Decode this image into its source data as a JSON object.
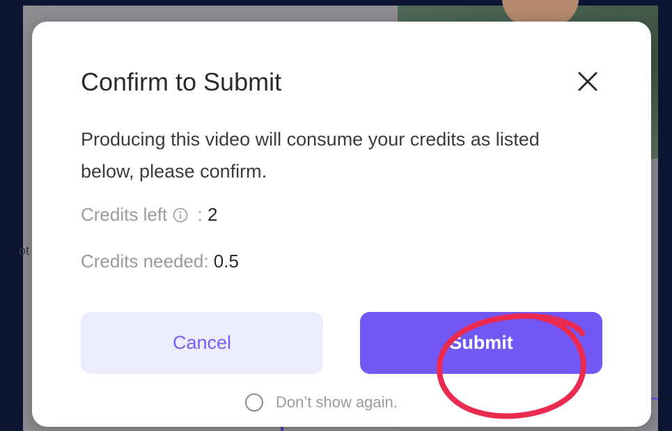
{
  "dialog": {
    "title": "Confirm to Submit",
    "description": "Producing this video will consume your credits as listed below, please confirm.",
    "credits_left_label": "Credits left",
    "credits_left_separator": " : ",
    "credits_left_value": "2",
    "credits_needed_label": "Credits needed: ",
    "credits_needed_value": "0.5",
    "cancel_label": "Cancel",
    "submit_label": "Submit",
    "dont_show_label": "Don’t show again."
  },
  "icons": {
    "close": "close-icon",
    "info": "info-icon",
    "checkbox": "radio-circle"
  },
  "colors": {
    "primary": "#7458f6",
    "cancel_bg": "#ebedfd",
    "annotation": "#ea2a4f",
    "page_bg": "#0d1533"
  }
}
